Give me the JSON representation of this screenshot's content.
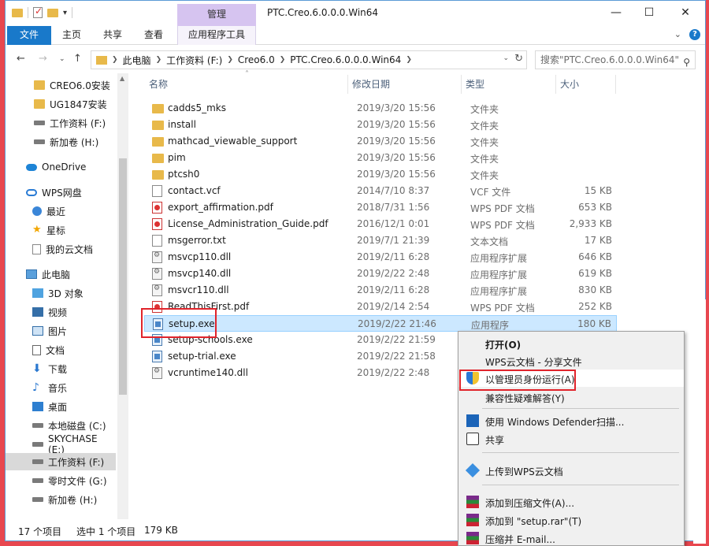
{
  "window": {
    "title": "PTC.Creo.6.0.0.0.Win64",
    "manage_tab": "管理",
    "tools_tab": "应用程序工具"
  },
  "ribbon": {
    "file": "文件",
    "home": "主页",
    "share": "共享",
    "view": "查看"
  },
  "address": {
    "crumbs": [
      "此电脑",
      "工作资料 (F:)",
      "Creo6.0",
      "PTC.Creo.6.0.0.0.Win64"
    ],
    "search_placeholder": "搜索\"PTC.Creo.6.0.0.0.Win64\""
  },
  "sidebar": {
    "items": [
      {
        "label": "CREO6.0安装",
        "icon": "folder"
      },
      {
        "label": "UG1847安装",
        "icon": "folder"
      },
      {
        "label": "工作资料 (F:)",
        "icon": "drive"
      },
      {
        "label": "新加卷 (H:)",
        "icon": "drive"
      },
      {
        "label": "OneDrive",
        "icon": "cloud"
      },
      {
        "label": "WPS网盘",
        "icon": "wps-cloud"
      },
      {
        "label": "最近",
        "icon": "clock"
      },
      {
        "label": "星标",
        "icon": "star"
      },
      {
        "label": "我的云文档",
        "icon": "doc"
      },
      {
        "label": "此电脑",
        "icon": "pc"
      },
      {
        "label": "3D 对象",
        "icon": "cube"
      },
      {
        "label": "视频",
        "icon": "video"
      },
      {
        "label": "图片",
        "icon": "picture"
      },
      {
        "label": "文档",
        "icon": "doc"
      },
      {
        "label": "下载",
        "icon": "download"
      },
      {
        "label": "音乐",
        "icon": "music"
      },
      {
        "label": "桌面",
        "icon": "desktop"
      },
      {
        "label": "本地磁盘 (C:)",
        "icon": "drive"
      },
      {
        "label": "SKYCHASE (E:)",
        "icon": "drive"
      },
      {
        "label": "工作资料 (F:)",
        "icon": "drive"
      },
      {
        "label": "零时文件 (G:)",
        "icon": "drive"
      },
      {
        "label": "新加卷 (H:)",
        "icon": "drive"
      }
    ]
  },
  "columns": {
    "name": "名称",
    "date": "修改日期",
    "type": "类型",
    "size": "大小"
  },
  "files": [
    {
      "name": "cadds5_mks",
      "date": "2019/3/20 15:56",
      "type": "文件夹",
      "size": "",
      "icon": "folder"
    },
    {
      "name": "install",
      "date": "2019/3/20 15:56",
      "type": "文件夹",
      "size": "",
      "icon": "folder"
    },
    {
      "name": "mathcad_viewable_support",
      "date": "2019/3/20 15:56",
      "type": "文件夹",
      "size": "",
      "icon": "folder"
    },
    {
      "name": "pim",
      "date": "2019/3/20 15:56",
      "type": "文件夹",
      "size": "",
      "icon": "folder"
    },
    {
      "name": "ptcsh0",
      "date": "2019/3/20 15:56",
      "type": "文件夹",
      "size": "",
      "icon": "folder"
    },
    {
      "name": "contact.vcf",
      "date": "2014/7/10 8:37",
      "type": "VCF 文件",
      "size": "15 KB",
      "icon": "doc"
    },
    {
      "name": "export_affirmation.pdf",
      "date": "2018/7/31 1:56",
      "type": "WPS PDF 文档",
      "size": "653 KB",
      "icon": "pdf"
    },
    {
      "name": "License_Administration_Guide.pdf",
      "date": "2016/12/1 0:01",
      "type": "WPS PDF 文档",
      "size": "2,933 KB",
      "icon": "pdf"
    },
    {
      "name": "msgerror.txt",
      "date": "2019/7/1 21:39",
      "type": "文本文档",
      "size": "17 KB",
      "icon": "doc"
    },
    {
      "name": "msvcp110.dll",
      "date": "2019/2/11 6:28",
      "type": "应用程序扩展",
      "size": "646 KB",
      "icon": "dll"
    },
    {
      "name": "msvcp140.dll",
      "date": "2019/2/22 2:48",
      "type": "应用程序扩展",
      "size": "619 KB",
      "icon": "dll"
    },
    {
      "name": "msvcr110.dll",
      "date": "2019/2/11 6:28",
      "type": "应用程序扩展",
      "size": "830 KB",
      "icon": "dll"
    },
    {
      "name": "ReadThisFirst.pdf",
      "date": "2019/2/14 2:54",
      "type": "WPS PDF 文档",
      "size": "252 KB",
      "icon": "pdf"
    },
    {
      "name": "setup.exe",
      "date": "2019/2/22 21:46",
      "type": "应用程序",
      "size": "180 KB",
      "icon": "exe",
      "selected": true
    },
    {
      "name": "setup-schools.exe",
      "date": "2019/2/22 21:59",
      "type": "应用程序",
      "size": "",
      "icon": "exe"
    },
    {
      "name": "setup-trial.exe",
      "date": "2019/2/22 21:58",
      "type": "应用程序",
      "size": "",
      "icon": "exe"
    },
    {
      "name": "vcruntime140.dll",
      "date": "2019/2/22 2:48",
      "type": "",
      "size": "",
      "icon": "dll"
    }
  ],
  "status": {
    "count": "17 个项目",
    "selected": "选中 1 个项目",
    "size": "179 KB"
  },
  "context_menu": {
    "items": [
      {
        "label": "打开(O)",
        "bold": true,
        "icon": ""
      },
      {
        "label": "WPS云文档 - 分享文件",
        "icon": ""
      },
      {
        "label": "以管理员身份运行(A)",
        "icon": "shield"
      },
      {
        "label": "兼容性疑难解答(Y)",
        "icon": ""
      },
      {
        "label": "使用 Windows Defender扫描...",
        "icon": "defender"
      },
      {
        "label": "共享",
        "icon": "share"
      },
      {
        "label": "上传到WPS云文档",
        "icon": "cube"
      },
      {
        "label": "添加到压缩文件(A)...",
        "icon": "rar"
      },
      {
        "label": "添加到 \"setup.rar\"(T)",
        "icon": "rar"
      },
      {
        "label": "压缩并 E-mail...",
        "icon": "rar"
      }
    ]
  }
}
